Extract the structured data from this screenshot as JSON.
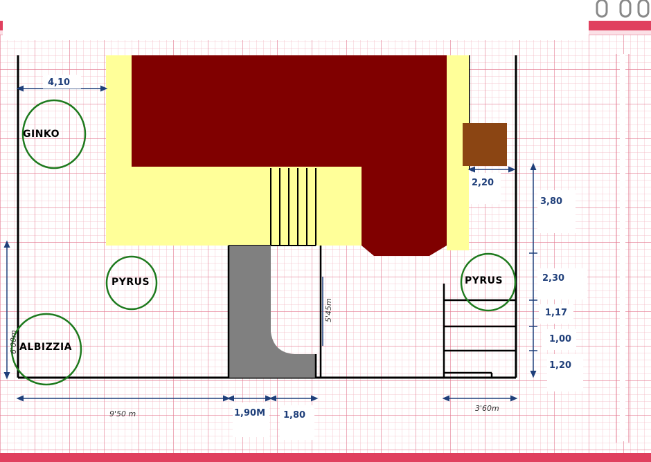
{
  "plants": {
    "ginko": "GINKO",
    "pyrus_left": "PYRUS",
    "pyrus_right": "PYRUS",
    "albizzia": "ALBIZZIA"
  },
  "dimensions": {
    "top_left_gap": "4,10",
    "shed_width": "2,20",
    "right_segment_1": "3,80",
    "right_segment_2": "2,30",
    "right_segment_3": "1,17",
    "right_segment_4": "1,00",
    "right_segment_5": "1,20",
    "bottom_driveway": "1,90M",
    "bottom_path": "1,80"
  },
  "handwritten": {
    "left_height": "6'00m",
    "bottom_left_length": "9'50 m",
    "bottom_right_length": "3'60m",
    "path_length": "5'45m"
  },
  "colors": {
    "house_roof": "#800000",
    "terrace": "#ffff99",
    "driveway": "#808080",
    "shed": "#8b4513",
    "tree_outline": "#1e7a1e",
    "grid_minor": "#f4b6c2",
    "grid_major": "#e3788f",
    "border_stripe": "#e0405e",
    "dimension_text": "#1f3f7a"
  },
  "icons": [
    "binder-ring-icon",
    "tree-canopy-icon",
    "dimension-arrow-icon"
  ]
}
